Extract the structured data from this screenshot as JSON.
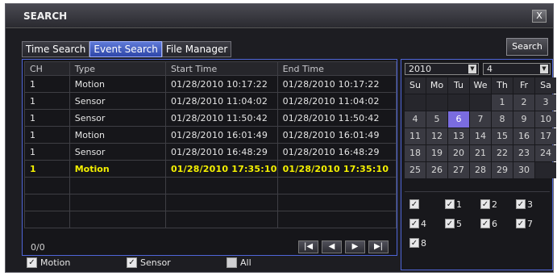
{
  "window": {
    "title": "SEARCH",
    "close_label": "X"
  },
  "tabs": [
    {
      "label": "Time Search"
    },
    {
      "label": "Event Search"
    },
    {
      "label": "File Manager"
    }
  ],
  "search_button": "Search",
  "table": {
    "headers": [
      "CH",
      "Type",
      "Start Time",
      "End Time"
    ],
    "rows": [
      {
        "ch": "1",
        "type": "Motion",
        "start": "01/28/2010  10:17:22",
        "end": "01/28/2010  10:17:22"
      },
      {
        "ch": "1",
        "type": "Sensor",
        "start": "01/28/2010  11:04:02",
        "end": "01/28/2010  11:04:02"
      },
      {
        "ch": "1",
        "type": "Sensor",
        "start": "01/28/2010  11:50:42",
        "end": "01/28/2010  11:50:42"
      },
      {
        "ch": "1",
        "type": "Motion",
        "start": "01/28/2010  16:01:49",
        "end": "01/28/2010  16:01:49"
      },
      {
        "ch": "1",
        "type": "Sensor",
        "start": "01/28/2010  16:48:29",
        "end": "01/28/2010  16:48:29"
      },
      {
        "ch": "1",
        "type": "Motion",
        "start": "01/28/2010  17:35:10",
        "end": "01/28/2010  17:35:10"
      }
    ],
    "highlight_color": "#f4f000"
  },
  "pager": {
    "count": "0/0"
  },
  "filters": [
    {
      "label": "Motion",
      "checked": true
    },
    {
      "label": "Sensor",
      "checked": true
    },
    {
      "label": "All",
      "checked": false
    }
  ],
  "calendar": {
    "year": "2010",
    "month": "4",
    "weekdays": [
      "Su",
      "Mo",
      "Tu",
      "We",
      "Th",
      "Fr",
      "Sa"
    ],
    "days": [
      "",
      "",
      "",
      "",
      "1",
      "2",
      "3",
      "4",
      "5",
      "6",
      "7",
      "8",
      "9",
      "10",
      "11",
      "12",
      "13",
      "14",
      "15",
      "16",
      "17",
      "18",
      "19",
      "20",
      "21",
      "22",
      "23",
      "24",
      "25",
      "26",
      "27",
      "28",
      "29",
      "30",
      ""
    ],
    "selected_day": "6",
    "selected_color": "#7a6ce0"
  },
  "channels": [
    {
      "label": "",
      "checked": true
    },
    {
      "label": "1",
      "checked": true
    },
    {
      "label": "2",
      "checked": true
    },
    {
      "label": "3",
      "checked": true
    },
    {
      "label": "4",
      "checked": true
    },
    {
      "label": "5",
      "checked": true
    },
    {
      "label": "6",
      "checked": true
    },
    {
      "label": "7",
      "checked": true
    },
    {
      "label": "8",
      "checked": true
    }
  ]
}
